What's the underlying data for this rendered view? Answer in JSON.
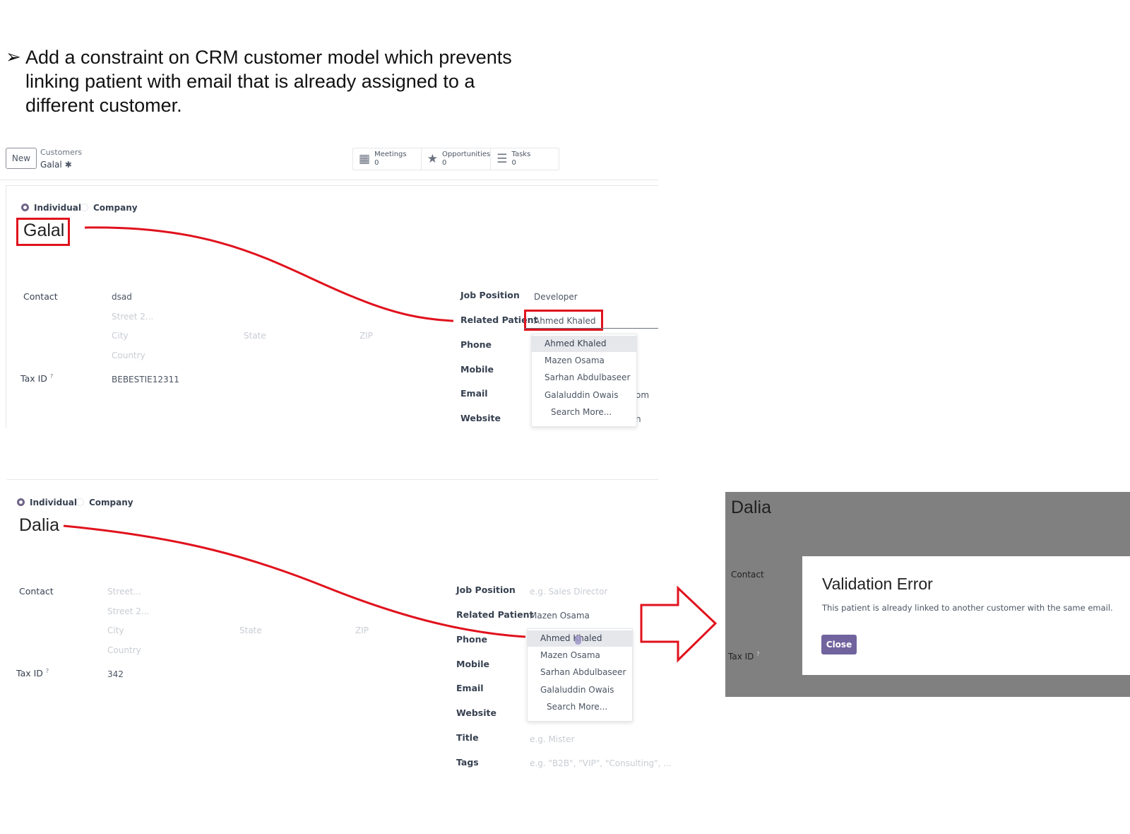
{
  "slide": {
    "instruction": "Add a constraint on CRM customer model which prevents linking patient with email that is already assigned to a different customer."
  },
  "control_panel": {
    "new_button": "New",
    "breadcrumb_parent": "Customers",
    "breadcrumb_current": "Galal",
    "smart_buttons": [
      {
        "label": "Meetings",
        "count": "0",
        "icon": "calendar-icon"
      },
      {
        "label": "Opportunities",
        "count": "0",
        "icon": "star-icon"
      },
      {
        "label": "Tasks",
        "count": "0",
        "icon": "tasks-icon"
      }
    ]
  },
  "form_top": {
    "type_options": {
      "individual": "Individual",
      "company": "Company",
      "selected": "Individual"
    },
    "name": "Galal",
    "labels": {
      "contact": "Contact",
      "tax_id": "Tax ID",
      "tax_help": "?"
    },
    "address": {
      "street": "dsad",
      "street2_ph": "Street 2...",
      "city_ph": "City",
      "state_ph": "State",
      "zip_ph": "ZIP",
      "country_ph": "Country"
    },
    "tax_id": "BEBESTIE12311",
    "right_labels": {
      "job_position": "Job Position",
      "related_patient": "Related Patient",
      "phone": "Phone",
      "mobile": "Mobile",
      "email": "Email",
      "website": "Website"
    },
    "job_position": "Developer",
    "related_patient": "Ahmed Khaled",
    "email_partial": "om",
    "website_partial": "n",
    "dropdown": [
      "Ahmed Khaled",
      "Mazen Osama",
      "Sarhan Abdulbaseer",
      "Galaluddin Owais"
    ],
    "search_more": "Search More..."
  },
  "form_bottom": {
    "type_options": {
      "individual": "Individual",
      "company": "Company",
      "selected": "Individual"
    },
    "name": "Dalia",
    "labels": {
      "contact": "Contact",
      "tax_id": "Tax ID",
      "tax_help": "?"
    },
    "address": {
      "street_ph": "Street...",
      "street2_ph": "Street 2...",
      "city_ph": "City",
      "state_ph": "State",
      "zip_ph": "ZIP",
      "country_ph": "Country"
    },
    "tax_id": "342",
    "right_labels": {
      "job_position": "Job Position",
      "related_patient": "Related Patient",
      "phone": "Phone",
      "mobile": "Mobile",
      "email": "Email",
      "website": "Website",
      "title": "Title",
      "tags": "Tags"
    },
    "job_position_ph": "e.g. Sales Director",
    "related_patient": "Mazen Osama",
    "title_ph": "e.g. Mister",
    "tags_ph": "e.g. \"B2B\", \"VIP\", \"Consulting\", ...",
    "dropdown": [
      "Ahmed Khaled",
      "Mazen Osama",
      "Sarhan Abdulbaseer",
      "Galaluddin Owais"
    ],
    "search_more": "Search More..."
  },
  "dialog": {
    "background_name": "Dalia",
    "background_contact": "Contact",
    "background_tax_id": "Tax ID",
    "tax_help": "?",
    "title": "Validation Error",
    "message": "This patient is already linked to another customer with the same email.",
    "close_button": "Close"
  },
  "colors": {
    "annotation_red": "#e0121d",
    "accent_purple": "#71639e",
    "overlay_gray": "#808080"
  }
}
